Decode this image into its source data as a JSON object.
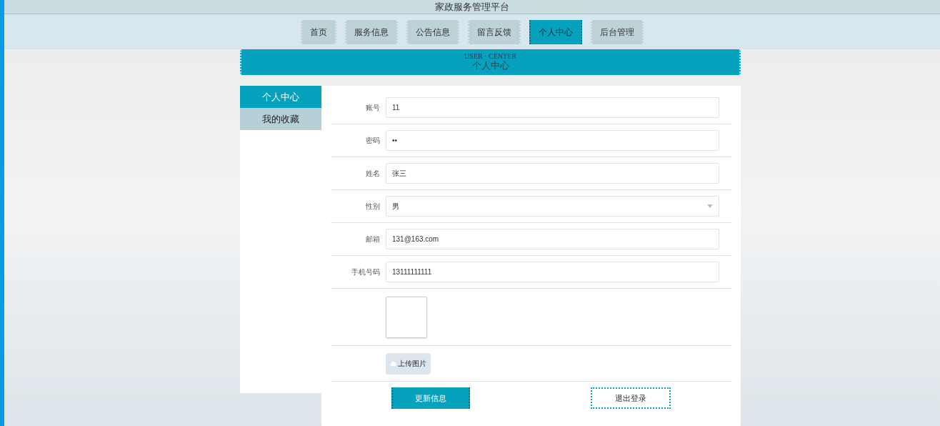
{
  "site_title": "家政服务管理平台",
  "nav": [
    {
      "label": "首页",
      "selected": false
    },
    {
      "label": "服务信息",
      "selected": false
    },
    {
      "label": "公告信息",
      "selected": false
    },
    {
      "label": "留言反馈",
      "selected": false
    },
    {
      "label": "个人中心",
      "selected": true
    },
    {
      "label": "后台管理",
      "selected": false
    }
  ],
  "banner": {
    "subtitle": "USER · CENTER",
    "title": "个人中心"
  },
  "sidebar": {
    "items": [
      {
        "label": "个人中心",
        "selected": true
      },
      {
        "label": "我的收藏",
        "selected": false
      }
    ]
  },
  "form": {
    "fields": [
      {
        "kind": "text",
        "label": "账号",
        "value": "11"
      },
      {
        "kind": "text",
        "label": "密码",
        "value": "••"
      },
      {
        "kind": "text",
        "label": "姓名",
        "value": "张三"
      },
      {
        "kind": "select",
        "label": "性别",
        "value": "男"
      },
      {
        "kind": "text",
        "label": "邮箱",
        "value": "131@163.com"
      },
      {
        "kind": "text",
        "label": "手机号码",
        "value": "13111111111"
      },
      {
        "kind": "image"
      },
      {
        "kind": "upload",
        "label": "上传图片"
      }
    ],
    "buttons": [
      {
        "kind": "primary",
        "label": "更新信息"
      },
      {
        "kind": "outline",
        "label": "退出登录"
      }
    ]
  }
}
